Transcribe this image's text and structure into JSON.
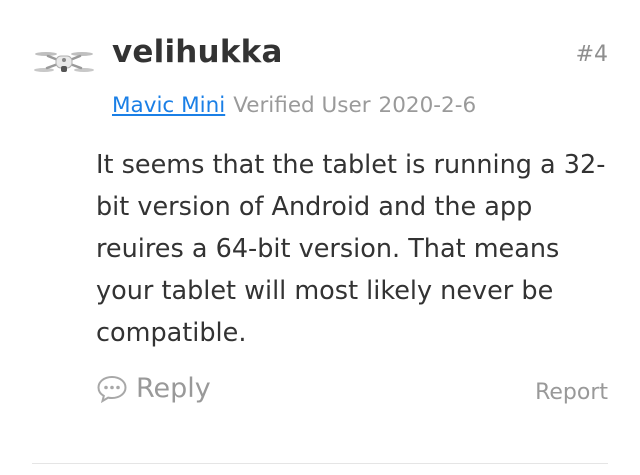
{
  "post": {
    "username": "velihukka",
    "post_number": "#4",
    "product_link": "Mavic Mini",
    "user_status": "Verified User",
    "date": "2020-2-6",
    "content": "It seems that the tablet is running a 32-bit version of Android and the app reuires a 64-bit version. That means your tablet will most likely never be compatible.",
    "reply_label": "Reply",
    "report_label": "Report"
  },
  "icons": {
    "avatar": "drone-icon",
    "reply": "speech-bubble-icon"
  },
  "colors": {
    "link": "#1a7fe6",
    "muted": "#9a9a9a",
    "text": "#333333"
  }
}
